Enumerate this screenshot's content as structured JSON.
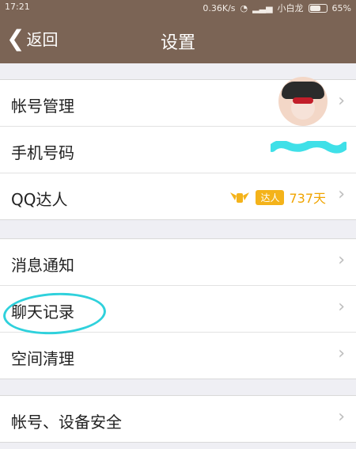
{
  "status": {
    "time": "17:21",
    "speed": "0.36K/s",
    "carrier": "小白龙",
    "battery": "65%"
  },
  "nav": {
    "back_label": "返回",
    "title": "设置"
  },
  "groups": [
    {
      "items": [
        {
          "label": "帐号管理"
        },
        {
          "label": "手机号码"
        },
        {
          "label": "QQ达人",
          "badge_label": "达人",
          "days": "737天"
        }
      ]
    },
    {
      "items": [
        {
          "label": "消息通知"
        },
        {
          "label": "聊天记录"
        },
        {
          "label": "空间清理"
        }
      ]
    },
    {
      "items": [
        {
          "label": "帐号、设备安全"
        }
      ]
    }
  ],
  "colors": {
    "header_bg": "#7b6455",
    "accent_badge": "#f4b31a",
    "annotation_circle": "#2fd1dc",
    "phone_blur": "#3fe0e8"
  }
}
